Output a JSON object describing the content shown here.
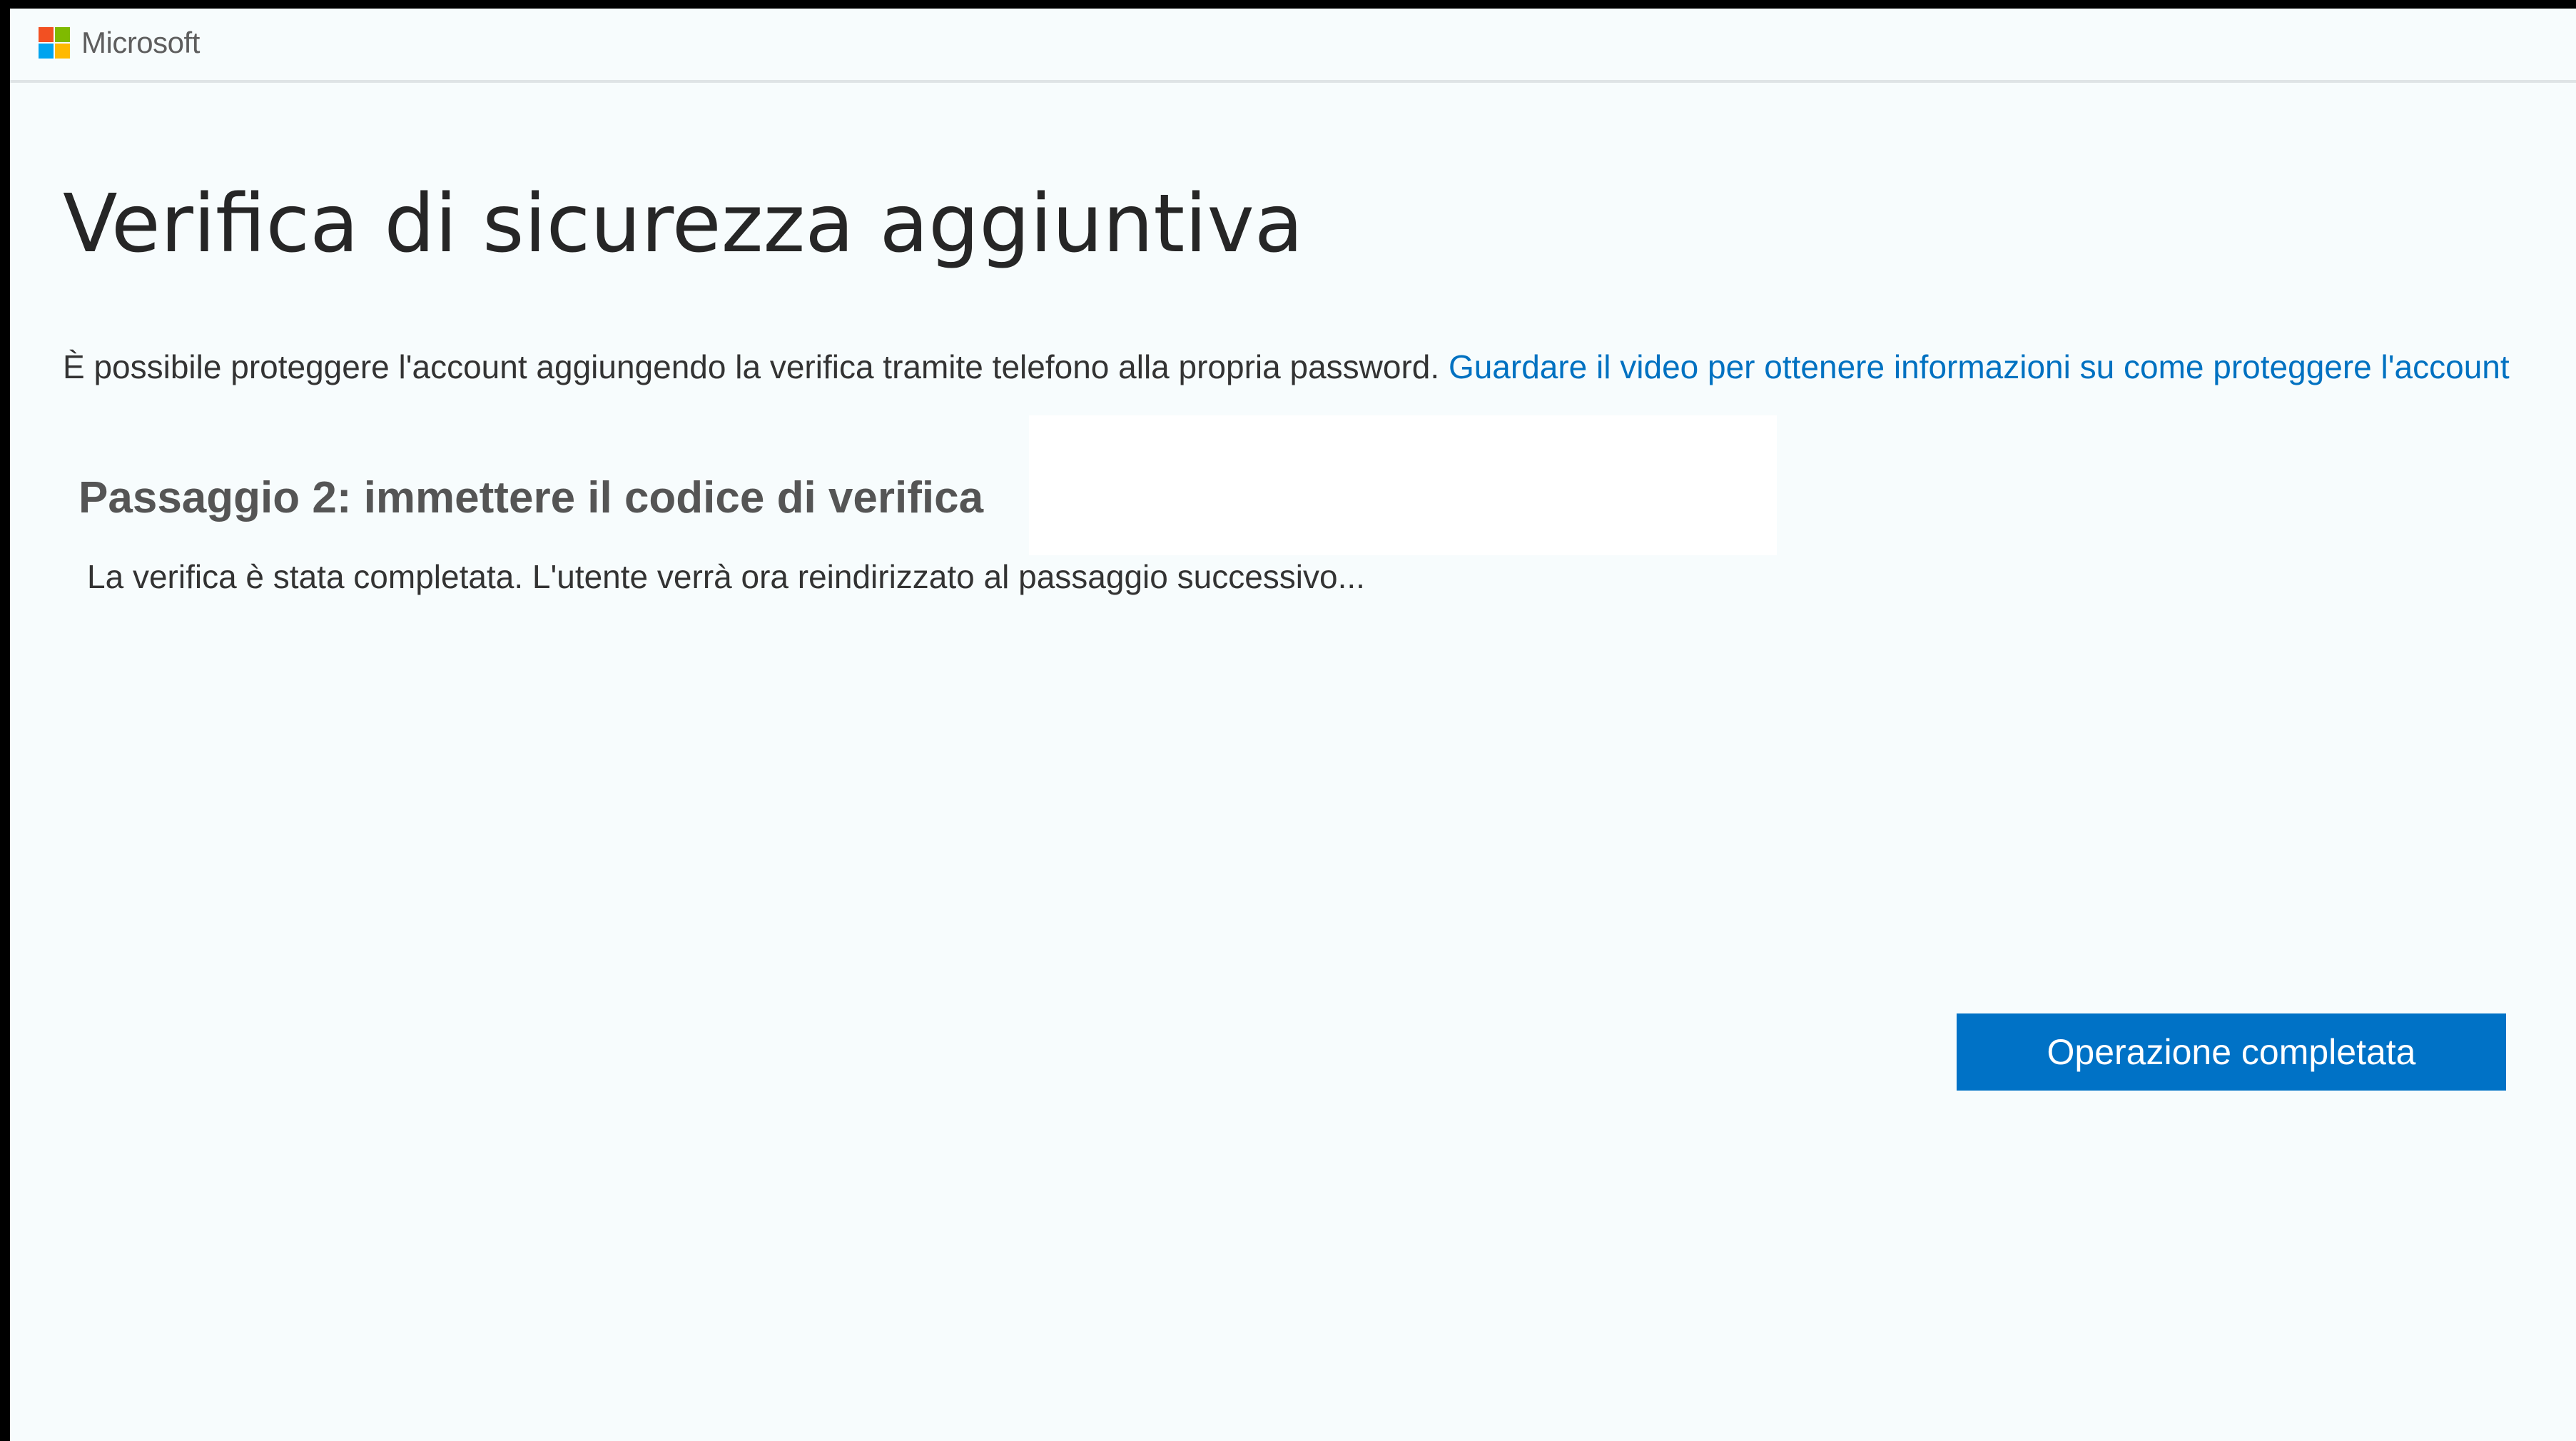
{
  "brand": {
    "logo_icon": "microsoft-logo-icon",
    "name": "Microsoft",
    "logo_colors": [
      "#f25022",
      "#7fba00",
      "#00a4ef",
      "#ffb900"
    ]
  },
  "page": {
    "title": "Verifica di sicurezza aggiuntiva",
    "intro_text": "È possibile proteggere l'account aggiungendo la verifica tramite telefono alla propria password.",
    "intro_link": "Guardare il video per ottenere informazioni su come proteggere l'account"
  },
  "step": {
    "heading": "Passaggio 2: immettere il codice di verifica",
    "message": "La verifica è stata completata. L'utente verrà ora reindirizzato al passaggio successivo..."
  },
  "actions": {
    "done_label": "Operazione completata"
  },
  "colors": {
    "accent": "#0072c6",
    "link": "#0071c1",
    "background": "#f7fcfd"
  }
}
